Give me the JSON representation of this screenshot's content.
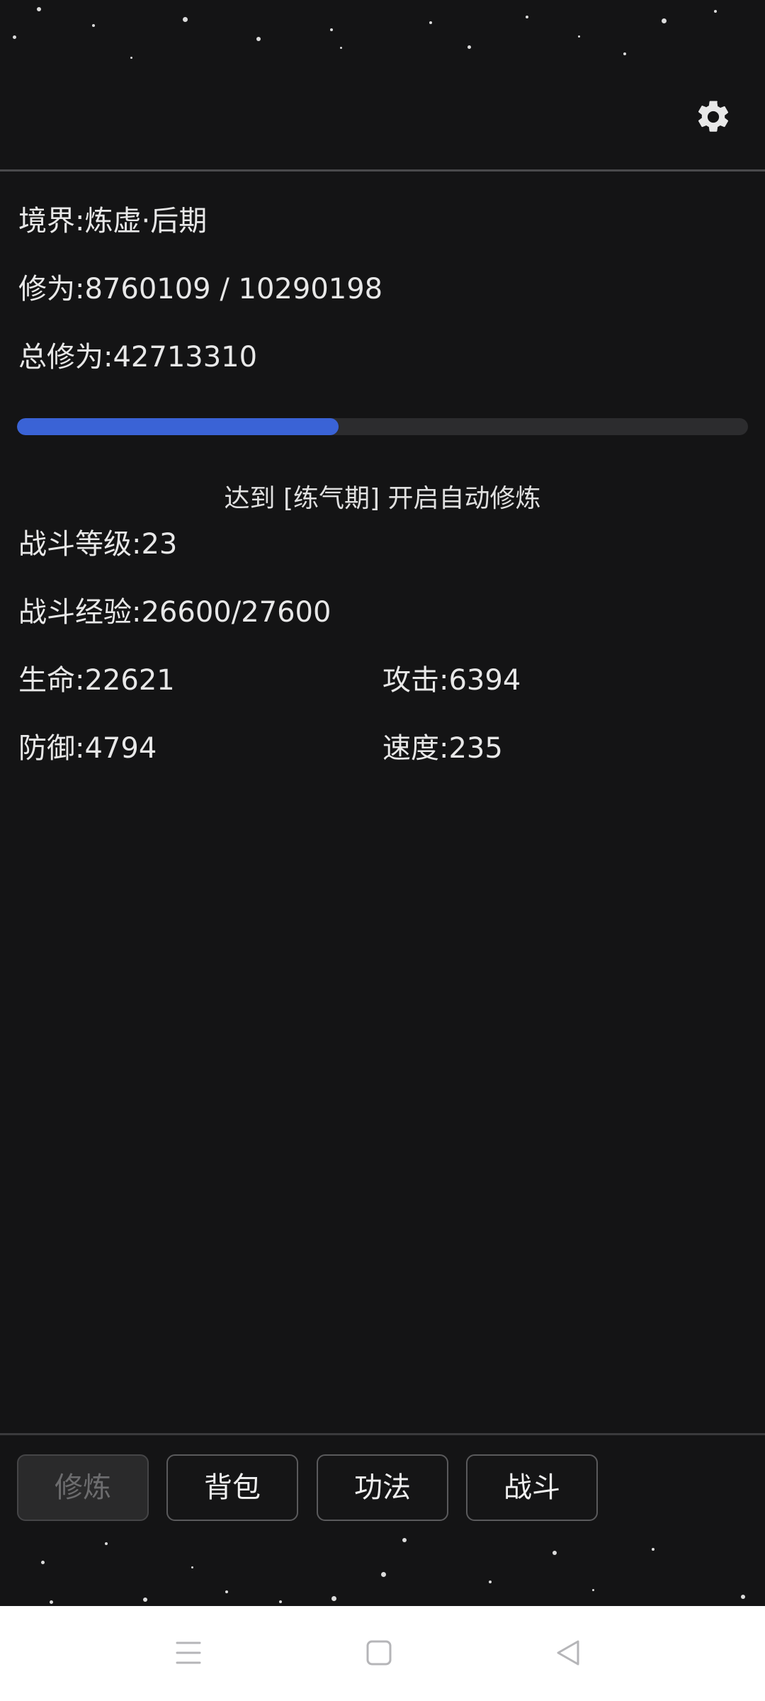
{
  "header": {
    "settings_icon": "gear-icon"
  },
  "cultivation": {
    "realm_label": "境界:",
    "realm_value": "炼虚·后期",
    "xiuwei_label": "修为:",
    "xiuwei_value": "8760109 / 10290198",
    "total_label": "总修为:",
    "total_value": "42713310",
    "progress_fraction": 0.44,
    "progress_color": "#3a63d6",
    "hint": "达到 [练气期] 开启自动修炼"
  },
  "combat": {
    "level_label": "战斗等级:",
    "level_value": "23",
    "exp_label": "战斗经验:",
    "exp_value": "26600/27600",
    "hp_label": "生命:",
    "hp_value": "22621",
    "atk_label": "攻击:",
    "atk_value": "6394",
    "def_label": "防御:",
    "def_value": "4794",
    "spd_label": "速度:",
    "spd_value": "235"
  },
  "nav": {
    "tabs": [
      {
        "label": "修炼",
        "disabled": true
      },
      {
        "label": "背包",
        "disabled": false
      },
      {
        "label": "功法",
        "disabled": false
      },
      {
        "label": "战斗",
        "disabled": false
      }
    ]
  },
  "system_bar": {
    "icons": [
      "menu-icon",
      "home-icon",
      "back-icon"
    ]
  },
  "colors": {
    "background": "#141415",
    "accent": "#3a63d6",
    "system_bar": "#ffffff"
  }
}
